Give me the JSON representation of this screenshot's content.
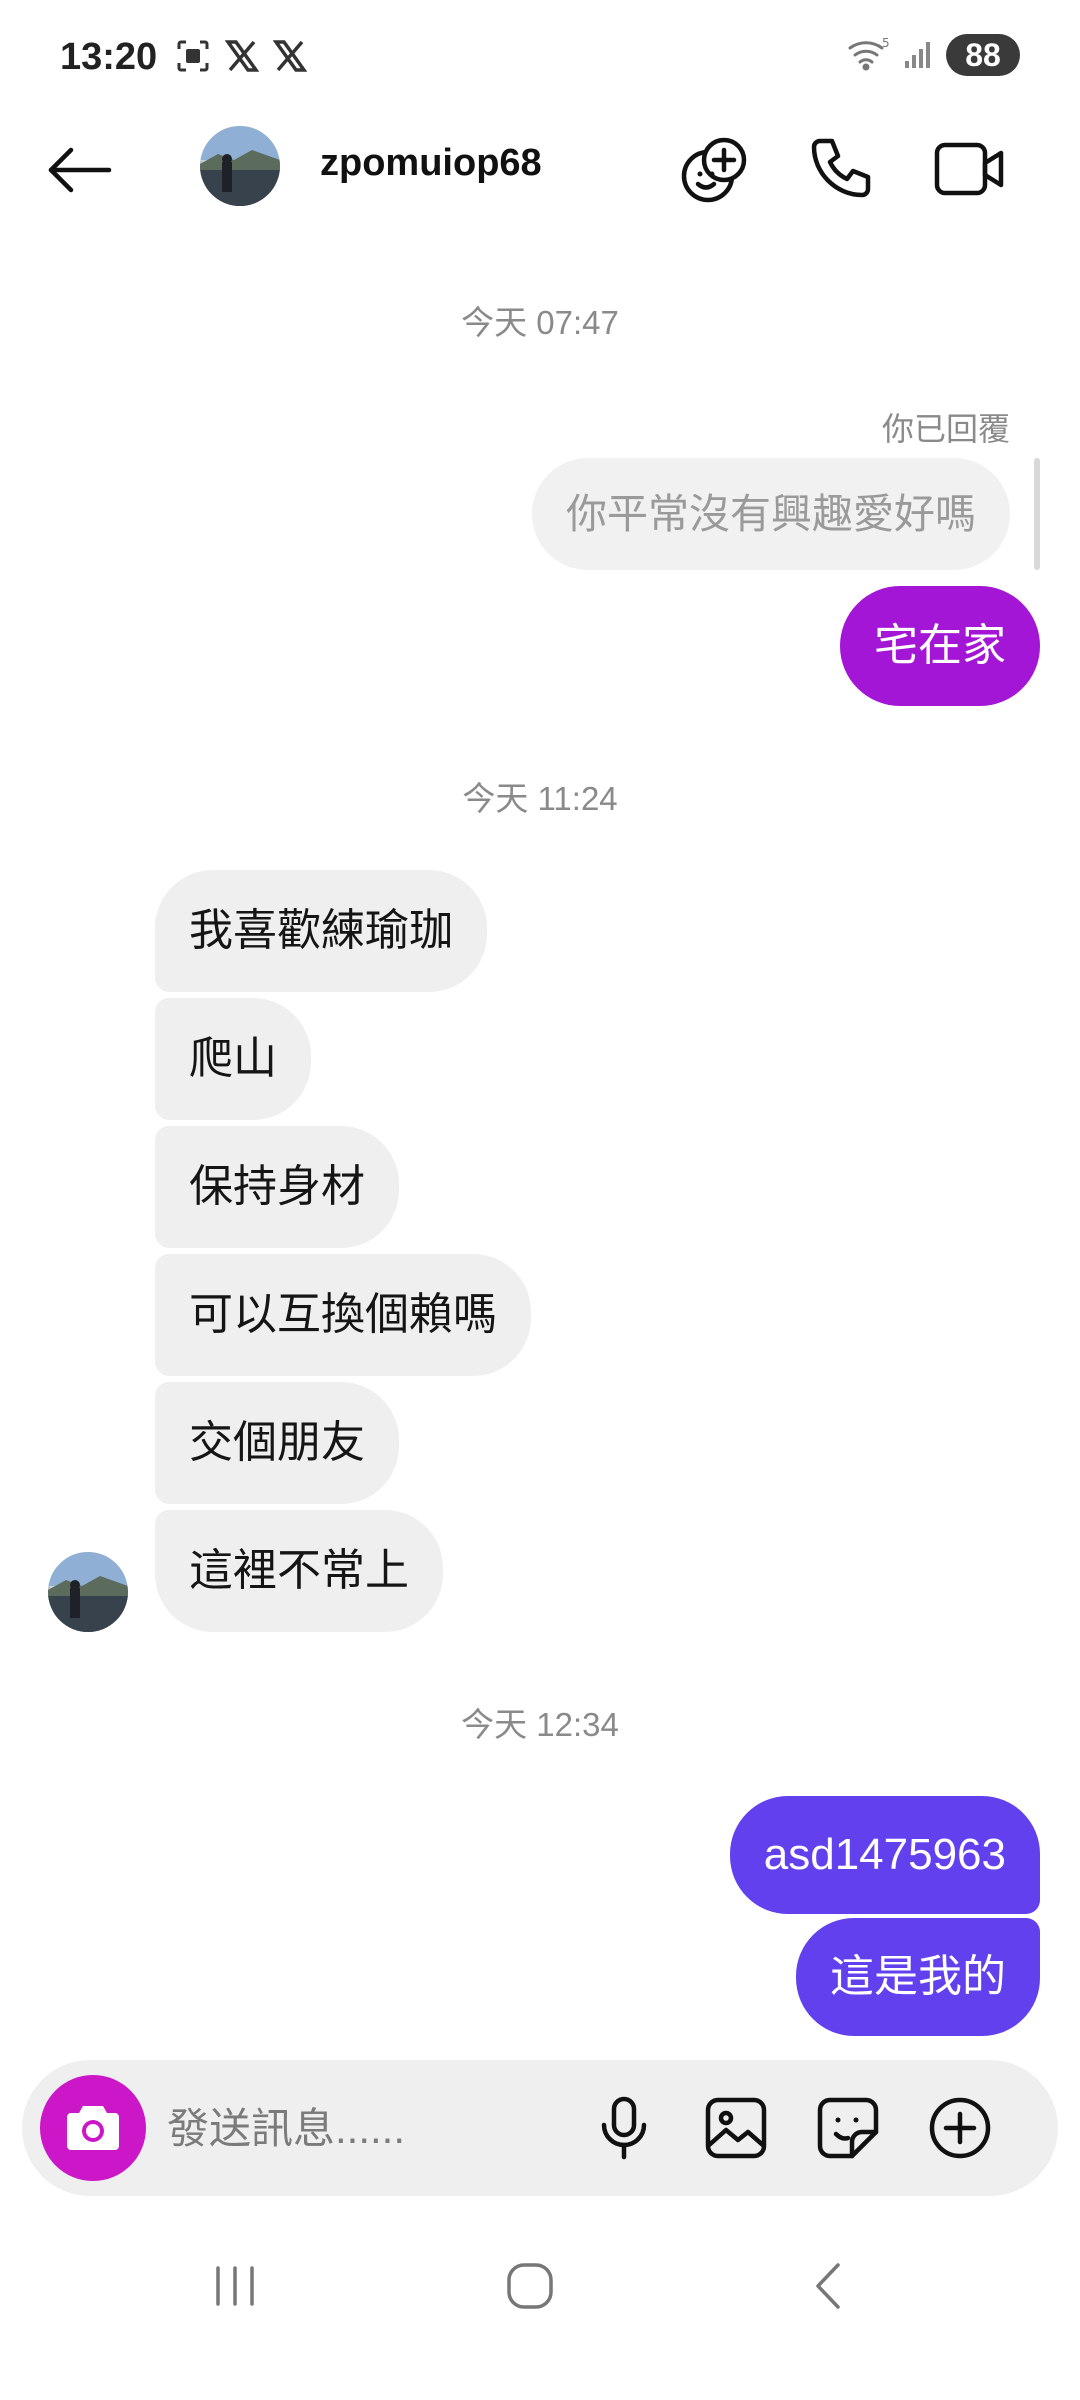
{
  "status_bar": {
    "time": "13:20",
    "battery": "88",
    "icons": [
      "screenshot-icon",
      "x-logo-icon",
      "x-logo-icon",
      "wifi-icon",
      "signal-icon"
    ]
  },
  "header": {
    "username": "zpomuiop68",
    "icons": [
      "back-arrow-icon",
      "game-icon",
      "phone-call-icon",
      "video-call-icon"
    ]
  },
  "conversation": {
    "timestamp_1": "今天 07:47",
    "replied_note": "你已回覆",
    "quoted_message": "你平常沒有興趣愛好嗎",
    "reply_message": "宅在家",
    "timestamp_2": "今天 11:24",
    "received": [
      "我喜歡練瑜珈",
      "爬山",
      "保持身材",
      "可以互換個賴嗎",
      "交個朋友",
      "這裡不常上"
    ],
    "timestamp_3": "今天 12:34",
    "sent": [
      "asd1475963",
      "這是我的"
    ]
  },
  "composer": {
    "placeholder": "發送訊息......",
    "icons": [
      "camera-icon",
      "microphone-icon",
      "gallery-icon",
      "sticker-icon",
      "plus-icon"
    ]
  },
  "colors": {
    "reply_bubble": "#a316d6",
    "sent_bubble": "#6240ee",
    "camera_button": "#cc17c8",
    "received_bubble": "#efefef"
  }
}
